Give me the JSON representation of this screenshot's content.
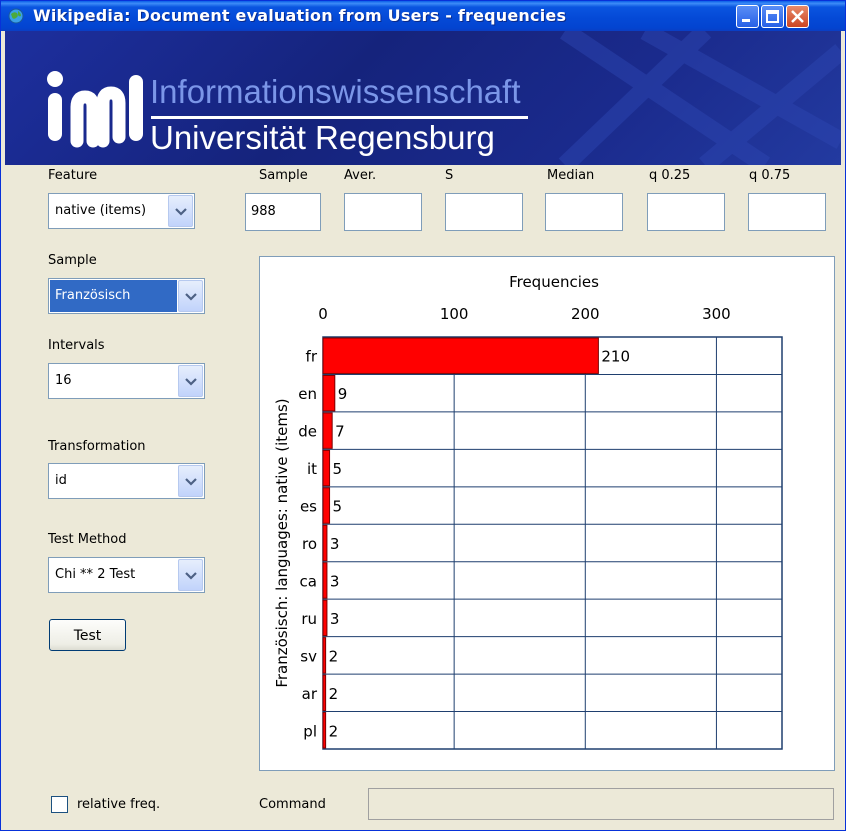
{
  "window": {
    "title": "Wikipedia: Document evaluation from Users - frequencies"
  },
  "banner": {
    "line1": "Informationswissenschaft",
    "line2": "Universität Regensburg"
  },
  "controls": {
    "feature_label": "Feature",
    "feature_value": "native (items)",
    "sample_label": "Sample",
    "sample_value": "Französisch",
    "intervals_label": "Intervals",
    "intervals_value": "16",
    "transformation_label": "Transformation",
    "transformation_value": "id",
    "test_method_label": "Test Method",
    "test_method_value": "Chi ** 2 Test",
    "test_button": "Test",
    "relative_freq_label": "relative freq.",
    "relative_freq_checked": false
  },
  "stats": {
    "sample_label": "Sample",
    "sample_value": "988",
    "aver_label": "Aver.",
    "aver_value": "",
    "s_label": "S",
    "s_value": "",
    "median_label": "Median",
    "median_value": "",
    "q025_label": "q 0.25",
    "q025_value": "",
    "q075_label": "q 0.75",
    "q075_value": ""
  },
  "command": {
    "label": "Command",
    "value": ""
  },
  "colors": {
    "bar": "#ff0000",
    "grid": "#1f3f6f",
    "title_bar": "#0a55e0"
  },
  "chart_data": {
    "type": "bar",
    "orientation": "horizontal",
    "title": "Frequencies",
    "ylabel": "Französisch: languages: native (items)",
    "categories": [
      "fr",
      "en",
      "de",
      "it",
      "es",
      "ro",
      "ca",
      "ru",
      "sv",
      "ar",
      "pl"
    ],
    "values": [
      210,
      9,
      7,
      5,
      5,
      3,
      3,
      3,
      2,
      2,
      2
    ],
    "xlim": [
      0,
      350
    ],
    "xticks": [
      "0",
      "100",
      "200",
      "300"
    ],
    "xtick_values": [
      0,
      100,
      200,
      300
    ],
    "grid": true
  }
}
